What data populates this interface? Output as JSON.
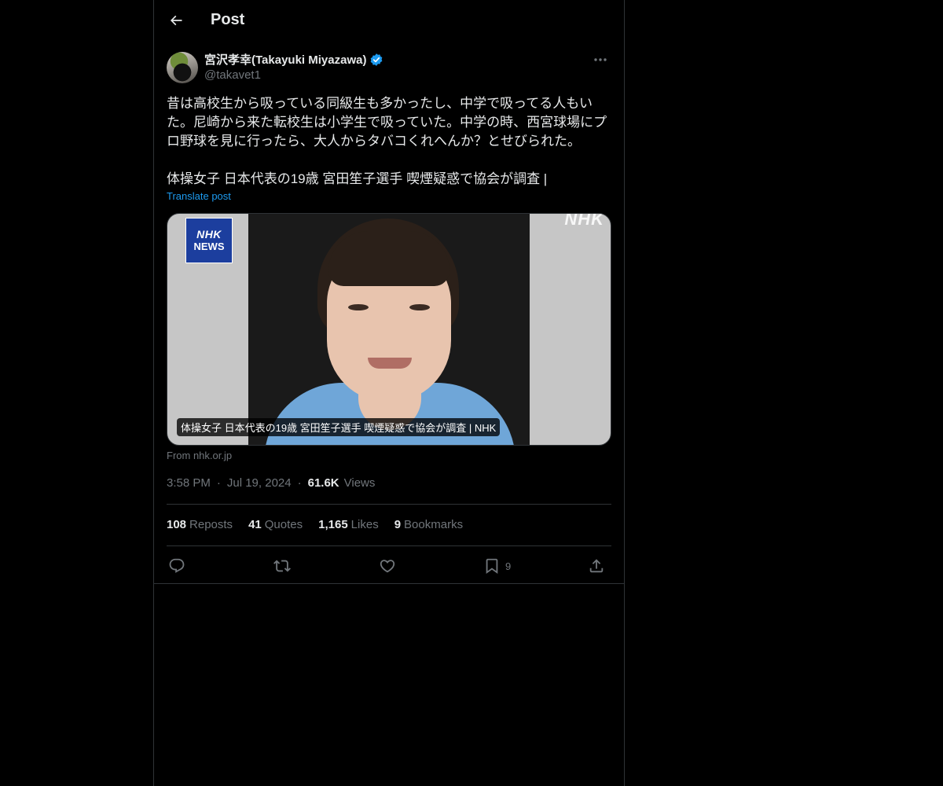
{
  "header": {
    "title": "Post"
  },
  "author": {
    "display_name": "宮沢孝幸(Takayuki Miyazawa)",
    "handle": "@takavet1",
    "verified": true,
    "verified_color": "#1d9bf0"
  },
  "post": {
    "text": "昔は高校生から吸っている同級生も多かったし、中学で吸ってる人もいた。尼崎から来た転校生は小学生で吸っていた。中学の時、西宮球場にプロ野球を見に行ったら、大人からタバコくれへんか？とせびられた。\n\n体操女子 日本代表の19歳 宮田笙子選手 喫煙疑惑で協会が調査 |",
    "translate_label": "Translate post"
  },
  "card": {
    "logo_line1": "NHK",
    "logo_line2": "NEWS",
    "watermark": "NHK",
    "caption": "体操女子 日本代表の19歳 宮田笙子選手 喫煙疑惑で協会が調査 | NHK",
    "source": "From nhk.or.jp"
  },
  "meta": {
    "time": "3:58 PM",
    "date": "Jul 19, 2024",
    "views_count": "61.6K",
    "views_label": "Views"
  },
  "stats": {
    "reposts_count": "108",
    "reposts_label": "Reposts",
    "quotes_count": "41",
    "quotes_label": "Quotes",
    "likes_count": "1,165",
    "likes_label": "Likes",
    "bookmarks_count": "9",
    "bookmarks_label": "Bookmarks"
  },
  "actions": {
    "reply_icon": "reply-icon",
    "repost_icon": "repost-icon",
    "like_icon": "like-icon",
    "bookmark_icon": "bookmark-icon",
    "bookmark_count": "9",
    "share_icon": "share-icon"
  },
  "colors": {
    "background": "#000000",
    "text": "#e7e9ea",
    "muted": "#71767b",
    "link": "#1d9bf0",
    "border": "#2f3336"
  }
}
